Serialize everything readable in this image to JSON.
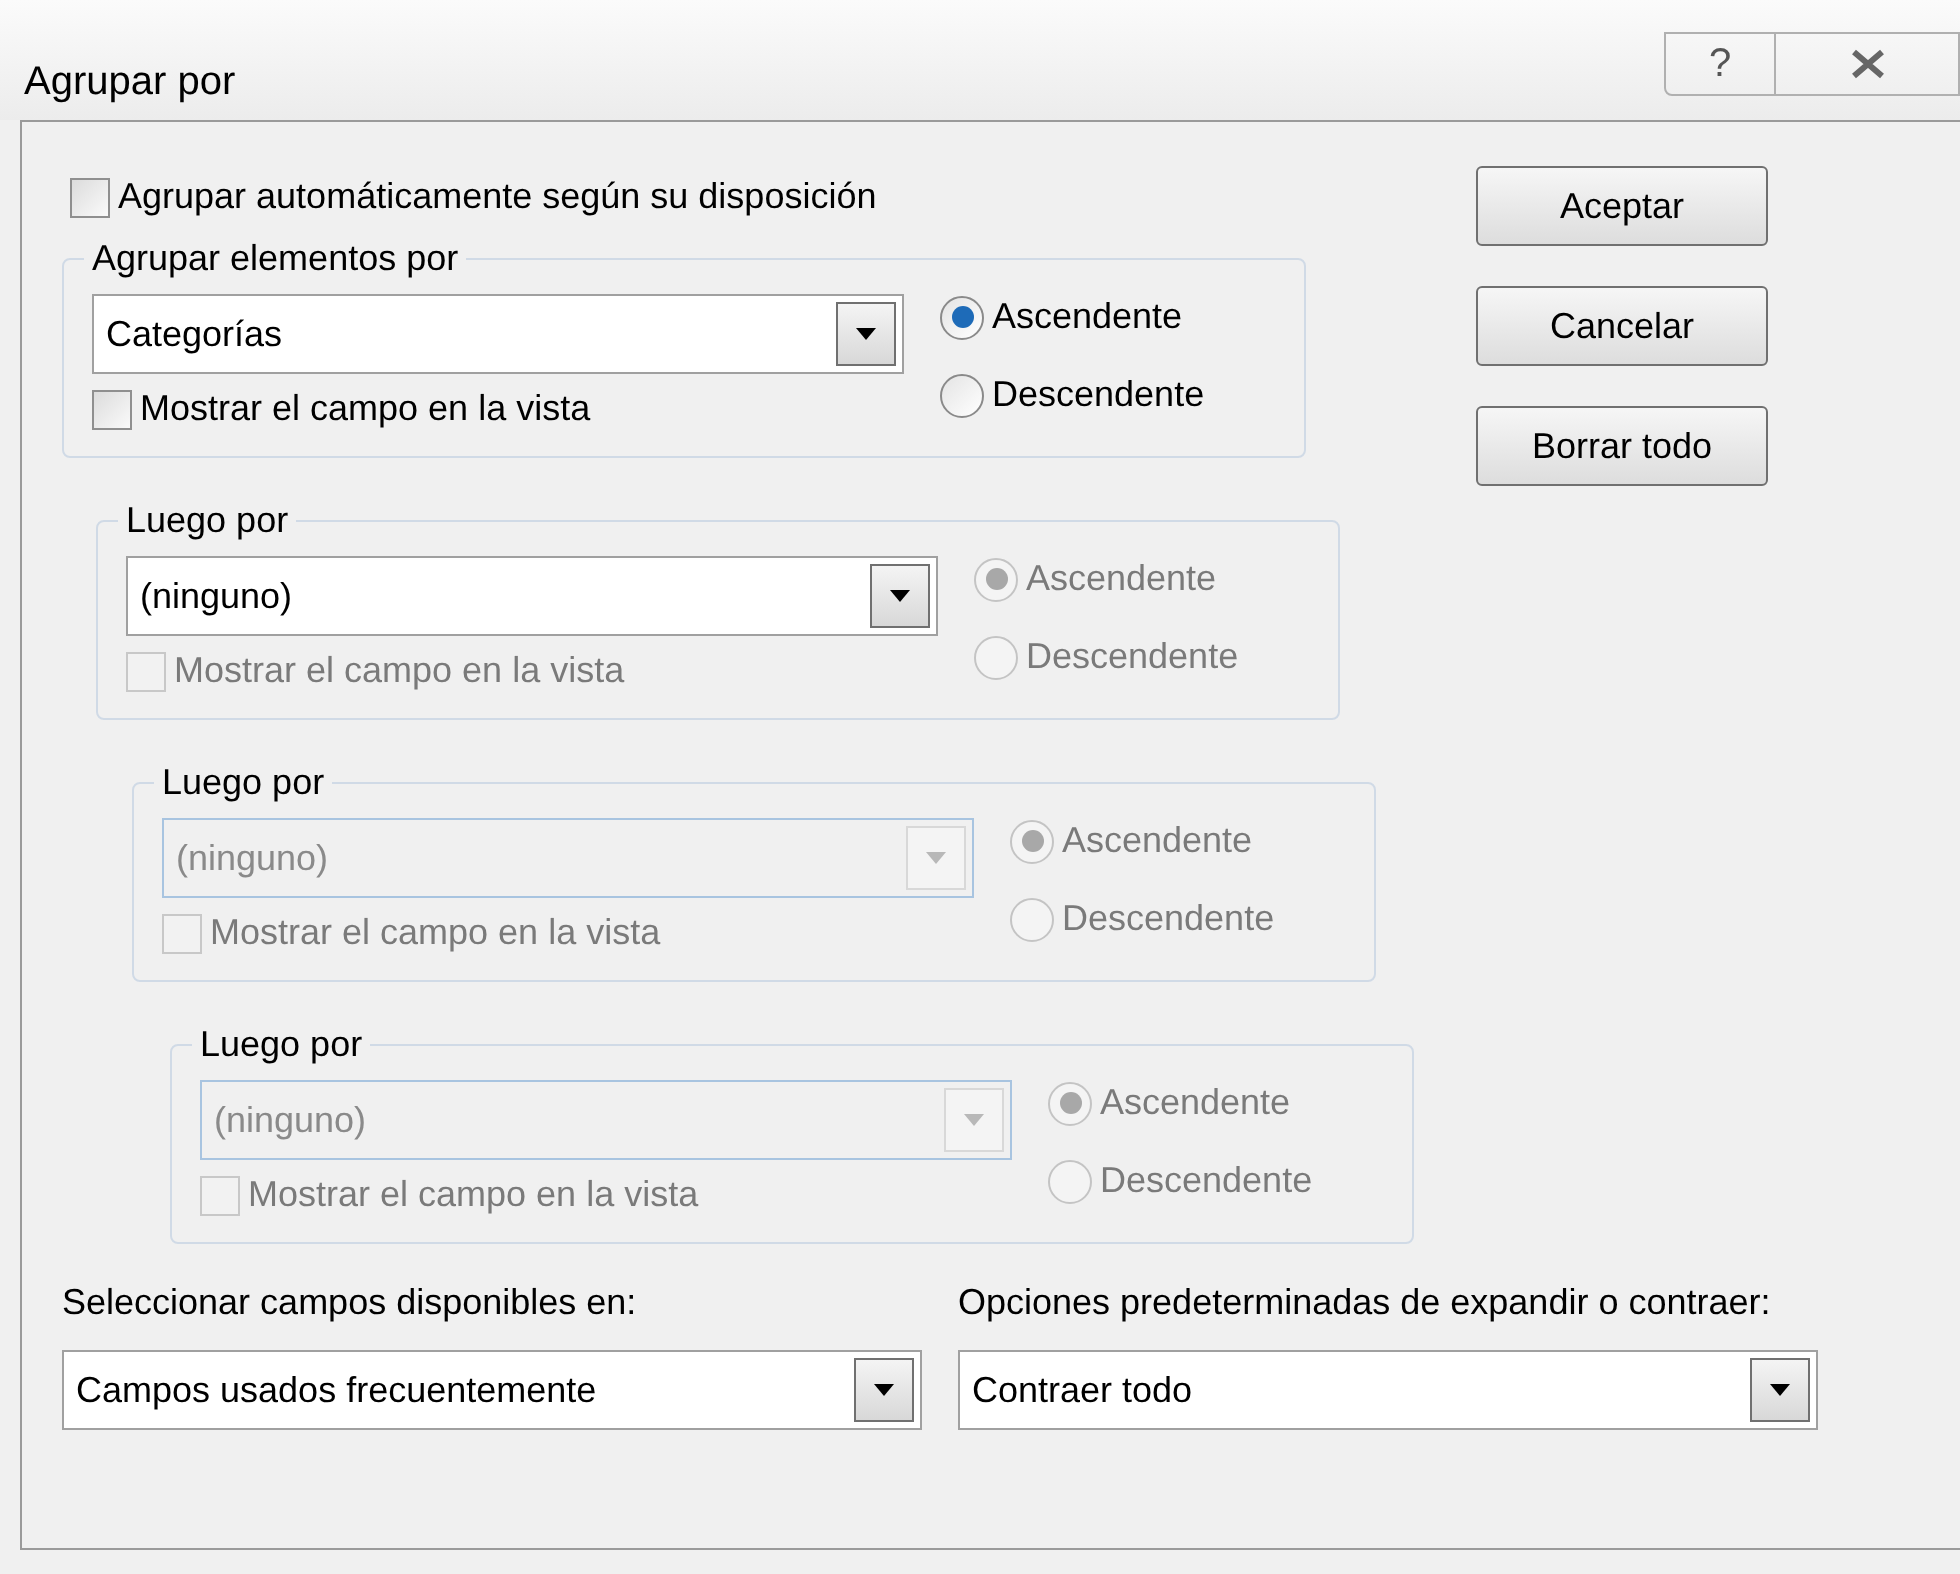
{
  "window": {
    "title": "Agrupar por",
    "help": "?"
  },
  "auto_group": {
    "label": "Agrupar automáticamente según su disposición",
    "checked": false
  },
  "groups": [
    {
      "legend": "Agrupar elementos por",
      "value": "Categorías",
      "combo_disabled": false,
      "show_field": {
        "label": "Mostrar el campo en la vista",
        "checked": false,
        "disabled": false
      },
      "radios": [
        {
          "label": "Ascendente",
          "selected": true,
          "disabled": false
        },
        {
          "label": "Descendente",
          "selected": false,
          "disabled": false
        }
      ]
    },
    {
      "legend": "Luego por",
      "value": "(ninguno)",
      "combo_disabled": false,
      "show_field": {
        "label": "Mostrar el campo en la vista",
        "checked": false,
        "disabled": true
      },
      "radios": [
        {
          "label": "Ascendente",
          "selected": true,
          "disabled": true
        },
        {
          "label": "Descendente",
          "selected": false,
          "disabled": true
        }
      ]
    },
    {
      "legend": "Luego por",
      "value": "(ninguno)",
      "combo_disabled": true,
      "show_field": {
        "label": "Mostrar el campo en la vista",
        "checked": false,
        "disabled": true
      },
      "radios": [
        {
          "label": "Ascendente",
          "selected": true,
          "disabled": true
        },
        {
          "label": "Descendente",
          "selected": false,
          "disabled": true
        }
      ]
    },
    {
      "legend": "Luego por",
      "value": "(ninguno)",
      "combo_disabled": true,
      "show_field": {
        "label": "Mostrar el campo en la vista",
        "checked": false,
        "disabled": true
      },
      "radios": [
        {
          "label": "Ascendente",
          "selected": true,
          "disabled": true
        },
        {
          "label": "Descendente",
          "selected": false,
          "disabled": true
        }
      ]
    }
  ],
  "buttons": [
    "Aceptar",
    "Cancelar",
    "Borrar todo"
  ],
  "fields_source": {
    "label": "Seleccionar campos disponibles en:",
    "value": "Campos usados frecuentemente"
  },
  "expand_options": {
    "label": "Opciones predeterminadas de expandir o contraer:",
    "value": "Contraer todo"
  }
}
